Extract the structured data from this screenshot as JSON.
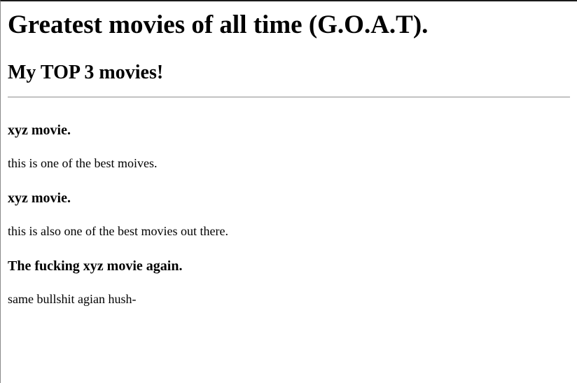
{
  "page": {
    "title": "Greatest movies of all time (G.O.A.T).",
    "subtitle": "My TOP 3 movies!"
  },
  "movies": [
    {
      "heading": "xyz movie.",
      "description": "this is one of the best moives."
    },
    {
      "heading": "xyz movie.",
      "description": "this is also one of the best movies out there."
    },
    {
      "heading": "The fucking xyz movie again.",
      "description": "same bullshit agian hush-"
    }
  ]
}
